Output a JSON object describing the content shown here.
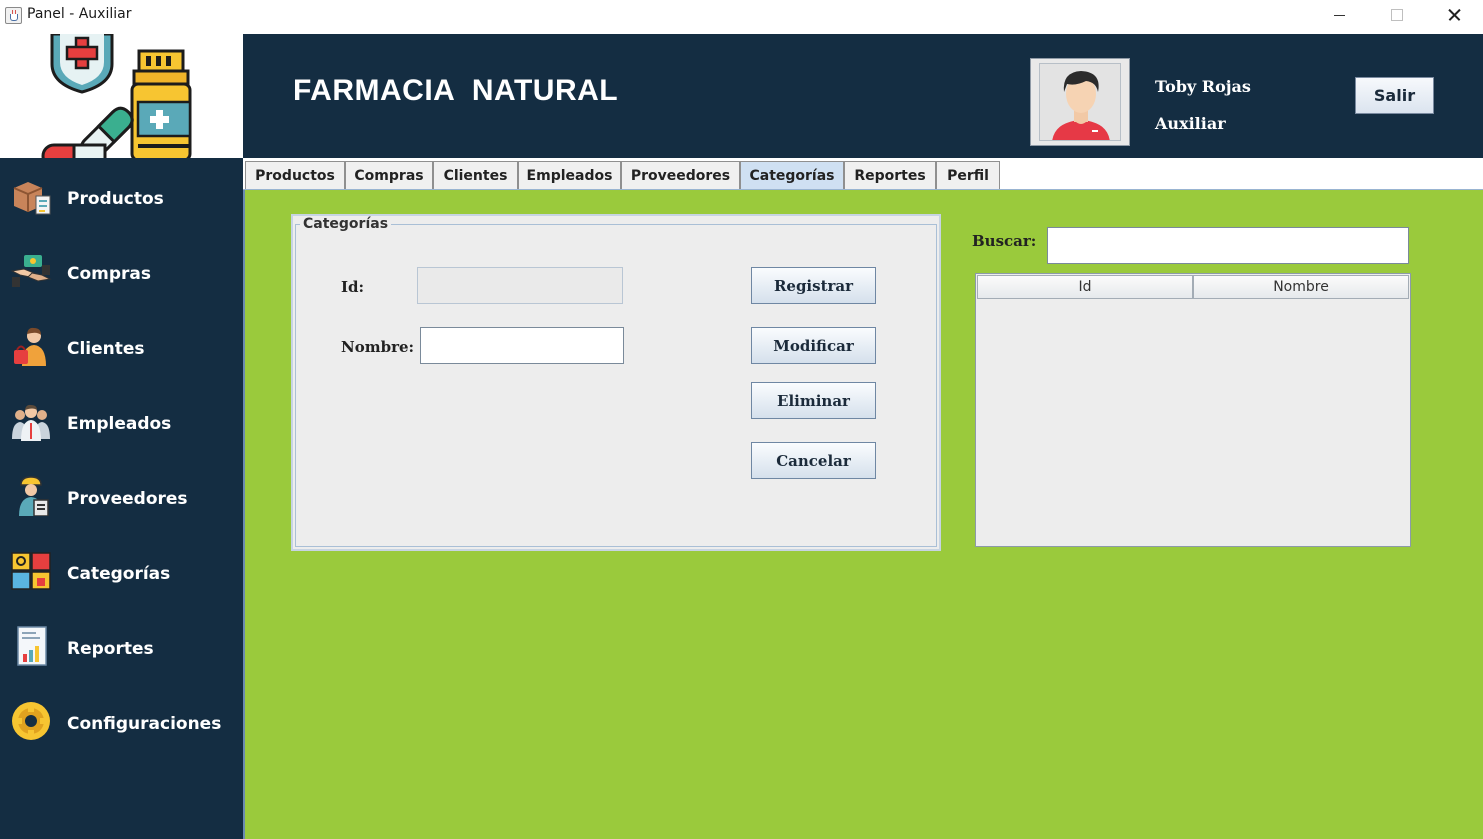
{
  "window": {
    "title": "Panel - Auxiliar",
    "icons": {
      "app": "java-cup-icon",
      "minimize": "minimize-icon",
      "maximize": "maximize-icon",
      "close": "close-icon"
    }
  },
  "logo": {
    "icon": "pharmacy-logo-icon"
  },
  "header": {
    "brand": "FARMACIA  NATURAL",
    "user_name": "Toby Rojas",
    "user_role": "Auxiliar",
    "logout_label": "Salir",
    "avatar_icon": "user-avatar-icon"
  },
  "sidebar": {
    "items": [
      {
        "label": "Productos",
        "icon": "box-icon"
      },
      {
        "label": "Compras",
        "icon": "handshake-money-icon"
      },
      {
        "label": "Clientes",
        "icon": "customer-icon"
      },
      {
        "label": "Empleados",
        "icon": "team-icon"
      },
      {
        "label": "Proveedores",
        "icon": "supplier-icon"
      },
      {
        "label": "Categorías",
        "icon": "categories-icon"
      },
      {
        "label": "Reportes",
        "icon": "report-icon"
      },
      {
        "label": "Configuraciones",
        "icon": "gear-icon"
      }
    ]
  },
  "tabs": [
    {
      "label": "Productos",
      "active": false
    },
    {
      "label": "Compras",
      "active": false
    },
    {
      "label": "Clientes",
      "active": false
    },
    {
      "label": "Empleados",
      "active": false
    },
    {
      "label": "Proveedores",
      "active": false
    },
    {
      "label": "Categorías",
      "active": true
    },
    {
      "label": "Reportes",
      "active": false
    },
    {
      "label": "Perfil",
      "active": false
    }
  ],
  "form": {
    "legend": "Categorías",
    "id_label": "Id:",
    "id_value": "",
    "name_label": "Nombre:",
    "name_value": "",
    "buttons": {
      "register": "Registrar",
      "modify": "Modificar",
      "delete": "Eliminar",
      "cancel": "Cancelar"
    }
  },
  "search": {
    "label": "Buscar:",
    "value": ""
  },
  "table": {
    "columns": [
      "Id",
      "Nombre"
    ],
    "rows": []
  },
  "colors": {
    "navy": "#142d42",
    "content_green": "#9aca3c",
    "active_tab": "#cfe0f2"
  }
}
